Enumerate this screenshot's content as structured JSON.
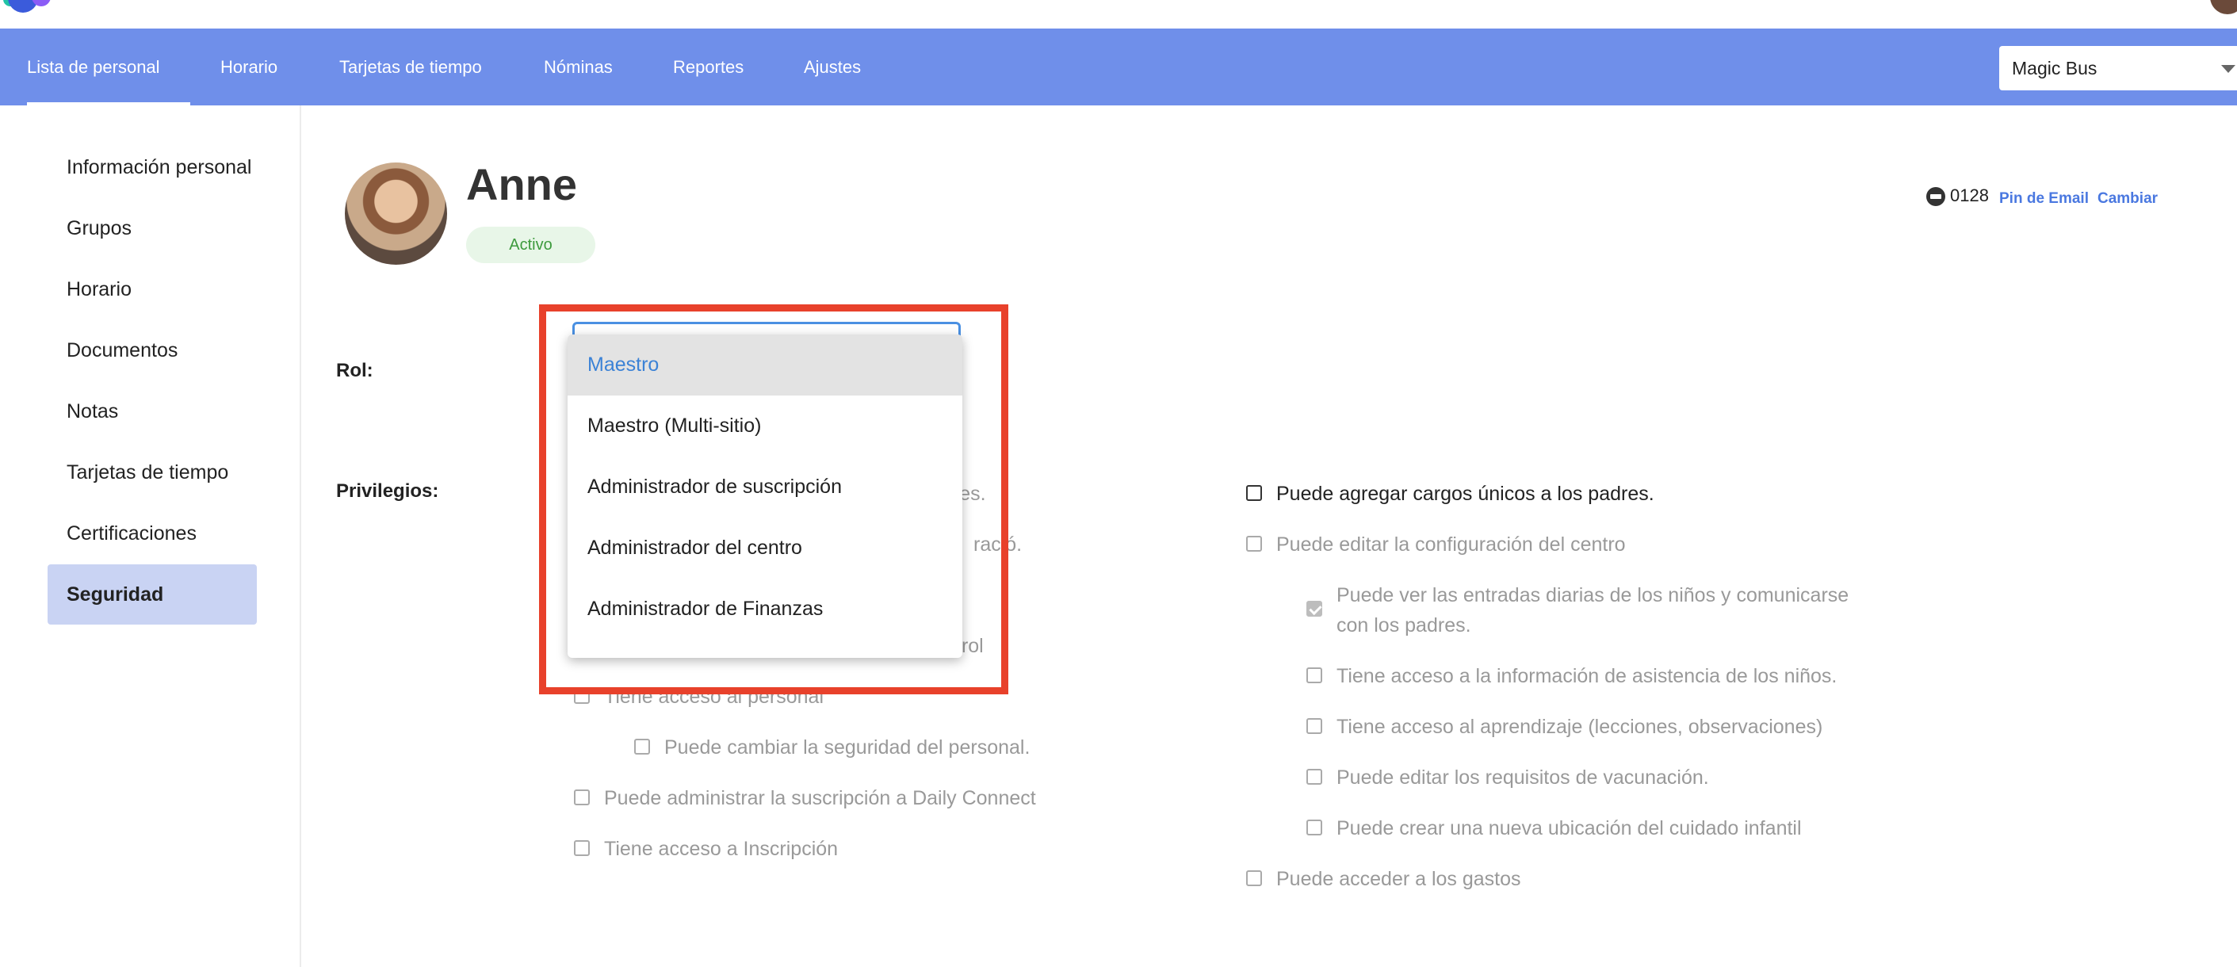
{
  "nav": {
    "items": [
      "Lista de personal",
      "Horario",
      "Tarjetas de tiempo",
      "Nóminas",
      "Reportes",
      "Ajustes"
    ],
    "site_select": "Magic Bus"
  },
  "sidebar": {
    "items": [
      "Información personal",
      "Grupos",
      "Horario",
      "Documentos",
      "Notas",
      "Tarjetas de tiempo",
      "Certificaciones",
      "Seguridad"
    ]
  },
  "profile": {
    "name": "Anne",
    "status": "Activo",
    "pin": "0128",
    "pin_email_link": "Pin de Email",
    "change_link": "Cambiar"
  },
  "role": {
    "label": "Rol:",
    "options": [
      "Maestro",
      "Maestro (Multi-sitio)",
      "Administrador de suscripción",
      "Administrador del centro",
      "Administrador de Finanzas"
    ],
    "selected": "Maestro"
  },
  "privileges": {
    "label": "Privilegios:",
    "left_partial": [
      "dres.",
      "ració.",
      "trol"
    ],
    "left": [
      "Tiene acceso al personal",
      "Puede cambiar la seguridad del personal.",
      "Puede administrar la suscripción a Daily Connect",
      "Tiene acceso a Inscripción"
    ],
    "right": [
      "Puede agregar cargos únicos a los padres.",
      "Puede editar la configuración del centro",
      "Puede ver las entradas diarias de los niños y comunicarse",
      "con los padres.",
      "Tiene acceso a la información de asistencia de los niños.",
      "Tiene acceso al aprendizaje (lecciones, observaciones)",
      "Puede editar los requisitos de vacunación.",
      "Puede crear una nueva ubicación del cuidado infantil",
      "Puede acceder a los gastos"
    ]
  }
}
